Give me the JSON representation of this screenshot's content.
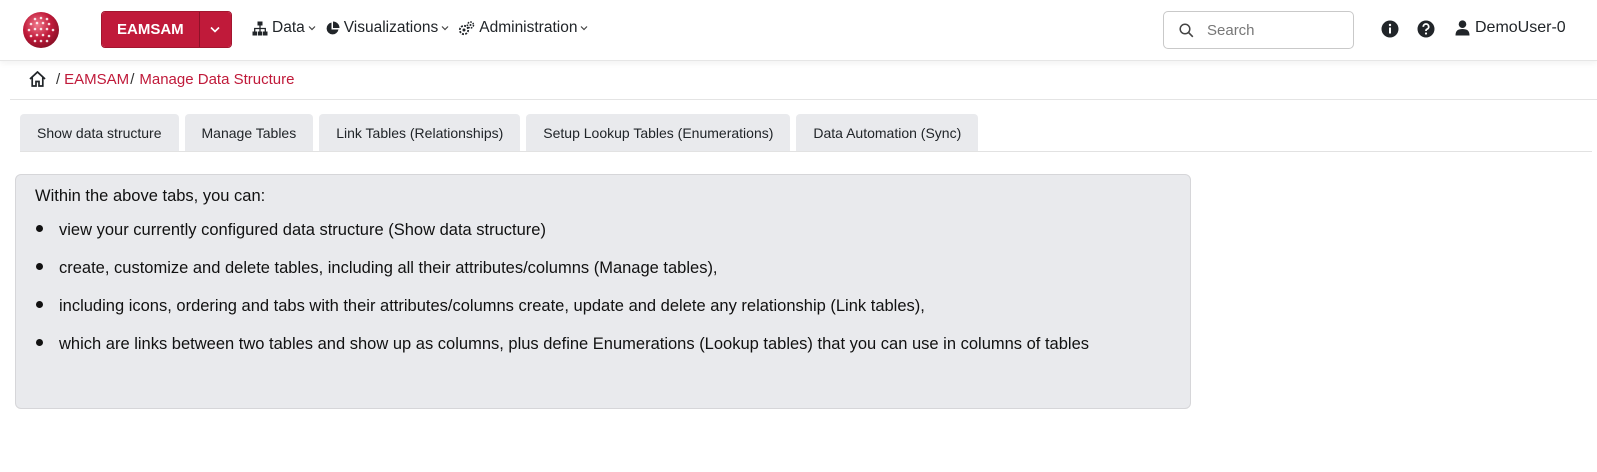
{
  "header": {
    "app_button_label": "EAMSAM",
    "menu": [
      {
        "label": "Data"
      },
      {
        "label": "Visualizations"
      },
      {
        "label": "Administration"
      }
    ],
    "search_placeholder": "Search",
    "user_name": "DemoUser-0"
  },
  "breadcrumb": {
    "items": [
      "EAMSAM",
      "Manage Data Structure"
    ]
  },
  "tabs": [
    {
      "label": "Show data structure"
    },
    {
      "label": "Manage Tables"
    },
    {
      "label": "Link Tables (Relationships)"
    },
    {
      "label": "Setup Lookup Tables (Enumerations)"
    },
    {
      "label": "Data Automation (Sync)"
    }
  ],
  "panel": {
    "intro": "Within the above tabs, you can:",
    "bullets": [
      "view your currently configured data structure (Show data structure)",
      "create, customize and delete tables, including all their attributes/columns (Manage tables),",
      "including icons, ordering and tabs with their attributes/columns create, update and delete any relationship (Link tables),",
      "which are links between two tables and show up as columns, plus define Enumerations (Lookup tables) that you can use in columns of tables"
    ]
  },
  "colors": {
    "brand": "#c01a3a",
    "tab_bg": "#e9eaed",
    "panel_bg": "#e9eaed"
  }
}
